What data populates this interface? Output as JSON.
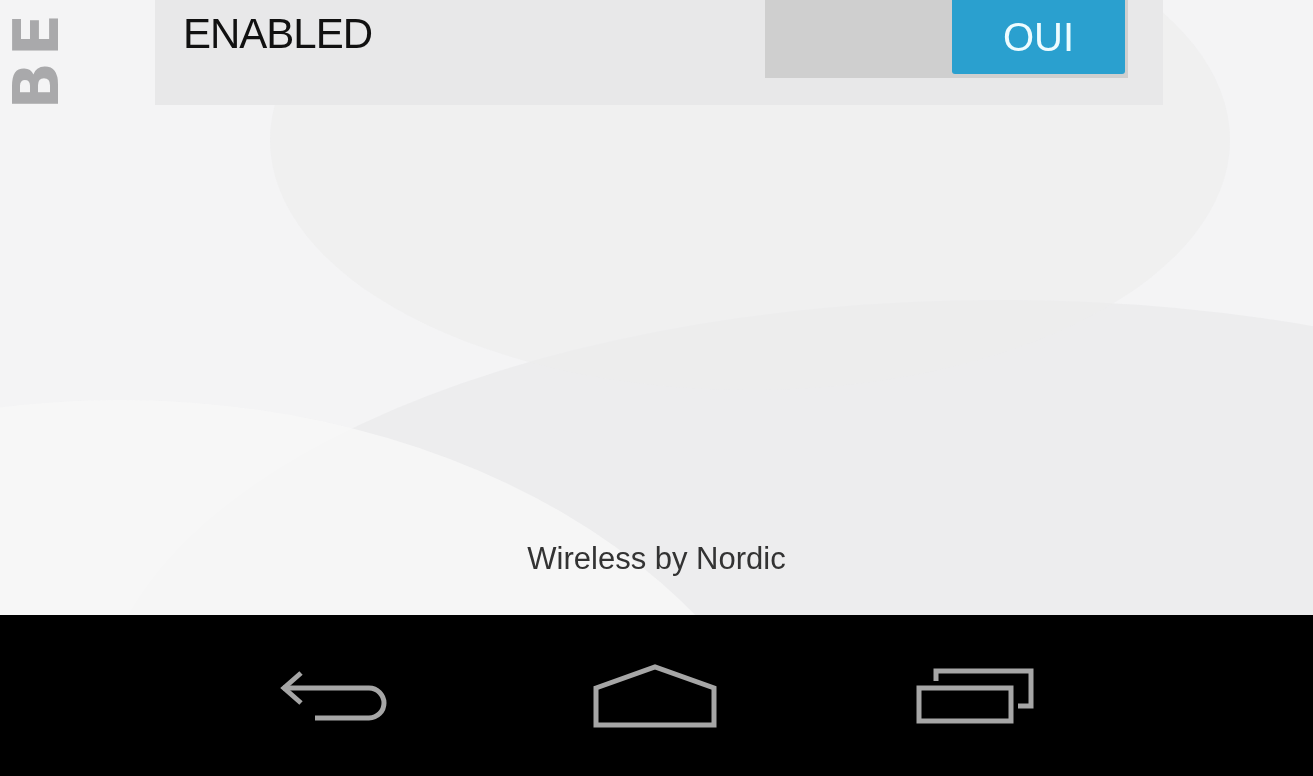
{
  "side_title": "BE",
  "setting": {
    "label": "ENABLED",
    "toggle": {
      "on": true,
      "text": "OUI"
    }
  },
  "footer": "Wireless by Nordic",
  "nav_bar": {
    "buttons": [
      {
        "kind": "back"
      },
      {
        "kind": "home"
      },
      {
        "kind": "recents"
      }
    ]
  }
}
